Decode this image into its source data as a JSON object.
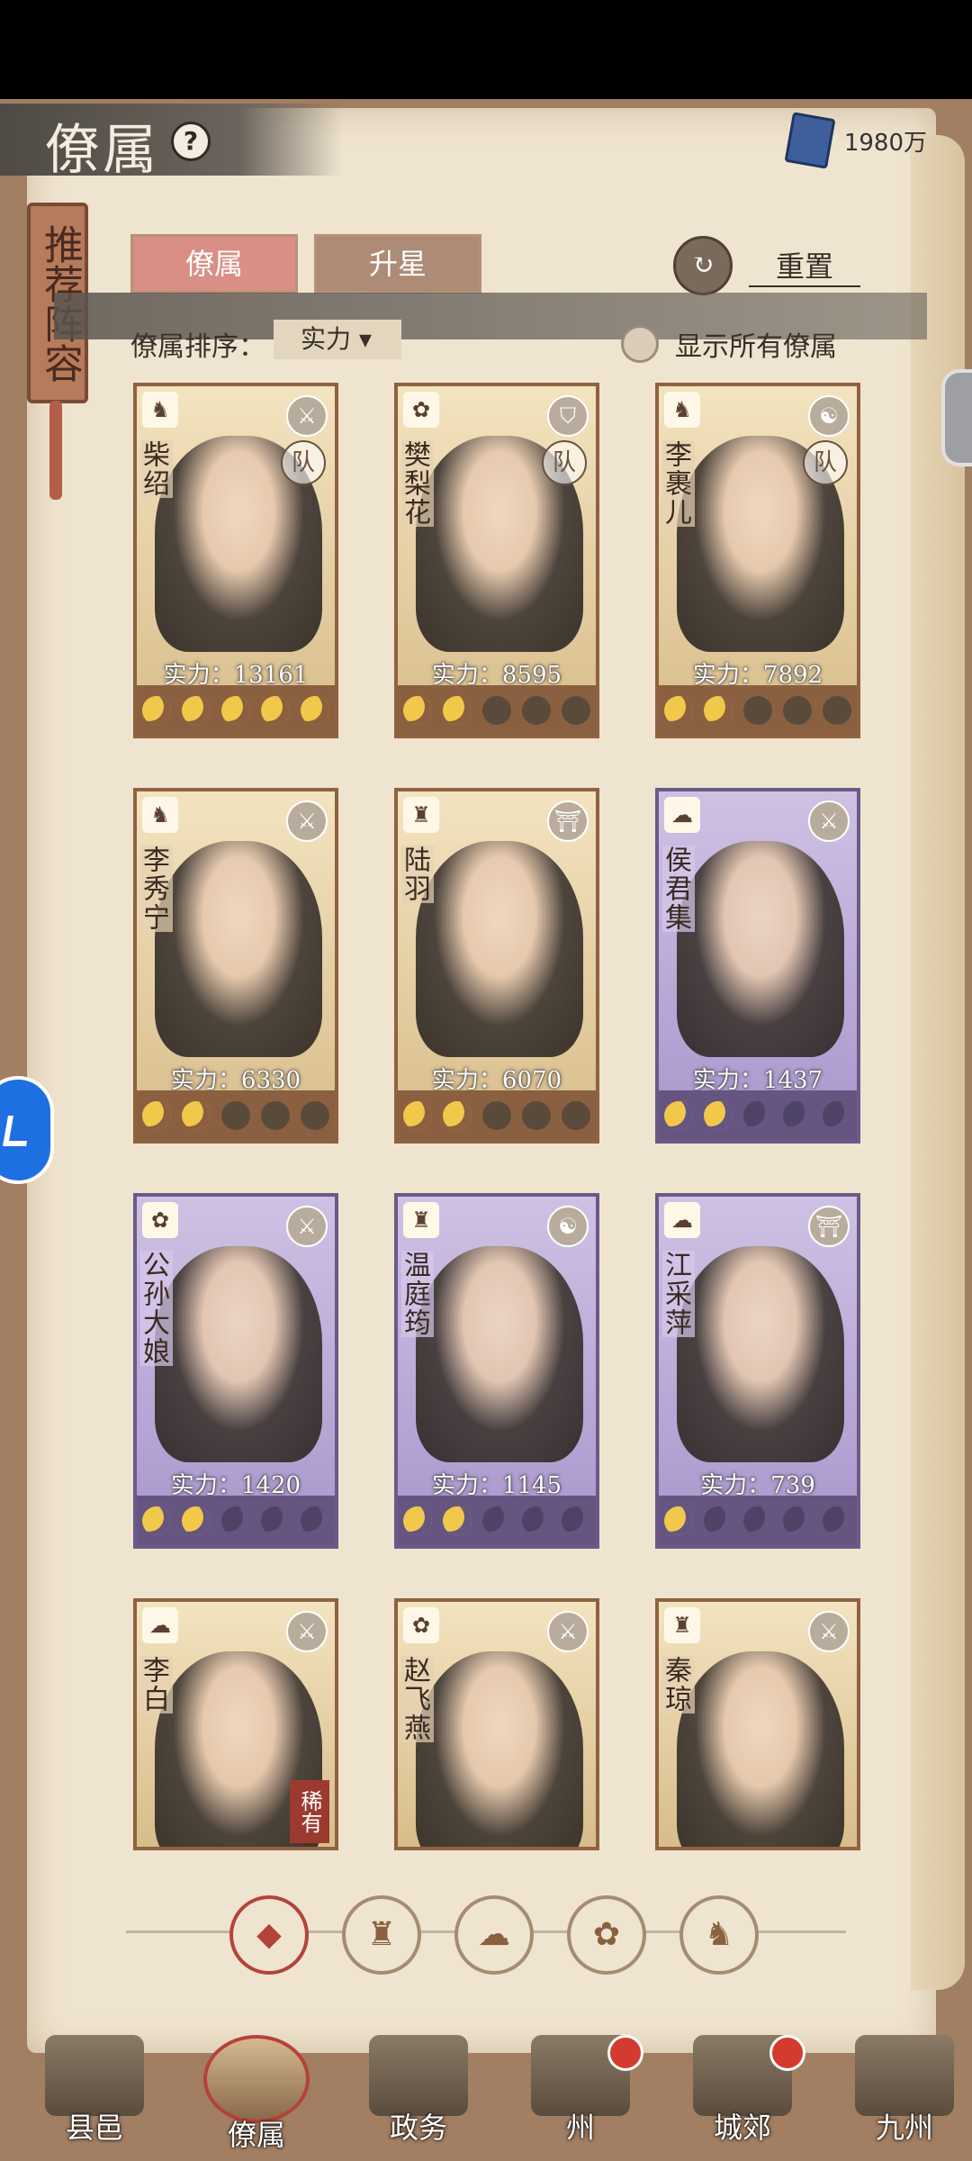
{
  "header": {
    "title": "僚属",
    "help_icon": "?",
    "currency_value": "1980万",
    "side_tag": "推荐阵容"
  },
  "tabs": [
    {
      "label": "僚属"
    },
    {
      "label": "升星"
    }
  ],
  "reset": {
    "label": "重置"
  },
  "sort": {
    "label": "僚属排序：",
    "value": "实力"
  },
  "show_all": {
    "label": "显示所有僚属"
  },
  "cards": [
    {
      "name": "柴绍",
      "power": "实力：13161",
      "stars": 5,
      "theme": "gold",
      "team": "队",
      "type_icon": "♞",
      "sect_icon": "⚔"
    },
    {
      "name": "樊梨花",
      "power": "实力：8595",
      "stars": 2,
      "theme": "gold",
      "team": "队",
      "type_icon": "✿",
      "sect_icon": "⛉"
    },
    {
      "name": "李裹儿",
      "power": "实力：7892",
      "stars": 2,
      "theme": "gold",
      "team": "队",
      "type_icon": "♞",
      "sect_icon": "☯"
    },
    {
      "name": "李秀宁",
      "power": "实力：6330",
      "stars": 2,
      "theme": "gold",
      "team": "",
      "type_icon": "♞",
      "sect_icon": "⚔"
    },
    {
      "name": "陆羽",
      "power": "实力：6070",
      "stars": 2,
      "theme": "gold",
      "team": "",
      "type_icon": "♜",
      "sect_icon": "⛩"
    },
    {
      "name": "侯君集",
      "power": "实力：1437",
      "stars": 2,
      "theme": "purple",
      "team": "",
      "type_icon": "☁",
      "sect_icon": "⚔"
    },
    {
      "name": "公孙大娘",
      "power": "实力：1420",
      "stars": 2,
      "theme": "purple",
      "team": "",
      "type_icon": "✿",
      "sect_icon": "⚔"
    },
    {
      "name": "温庭筠",
      "power": "实力：1145",
      "stars": 2,
      "theme": "purple",
      "team": "",
      "type_icon": "♜",
      "sect_icon": "☯"
    },
    {
      "name": "江采萍",
      "power": "实力：739",
      "stars": 1,
      "theme": "purple",
      "team": "",
      "type_icon": "☁",
      "sect_icon": "⛩"
    },
    {
      "name": "李白",
      "power": "",
      "stars": 0,
      "theme": "gold",
      "team": "",
      "type_icon": "☁",
      "sect_icon": "⚔",
      "rare": "稀有"
    },
    {
      "name": "赵飞燕",
      "power": "",
      "stars": 0,
      "theme": "gold",
      "team": "",
      "type_icon": "✿",
      "sect_icon": "⚔"
    },
    {
      "name": "秦琼",
      "power": "",
      "stars": 0,
      "theme": "gold",
      "team": "",
      "type_icon": "♜",
      "sect_icon": "⚔"
    }
  ],
  "filters": [
    {
      "icon": "◆",
      "active": true
    },
    {
      "icon": "♜",
      "active": false
    },
    {
      "icon": "☁",
      "active": false
    },
    {
      "icon": "✿",
      "active": false
    },
    {
      "icon": "♞",
      "active": false
    }
  ],
  "nav": [
    {
      "label": "县邑",
      "badge": false,
      "active": false
    },
    {
      "label": "僚属",
      "badge": false,
      "active": true
    },
    {
      "label": "政务",
      "badge": false,
      "active": false
    },
    {
      "label": "州",
      "badge": true,
      "active": false
    },
    {
      "label": "城郊",
      "badge": true,
      "active": false
    },
    {
      "label": "九州",
      "badge": false,
      "active": false
    }
  ]
}
